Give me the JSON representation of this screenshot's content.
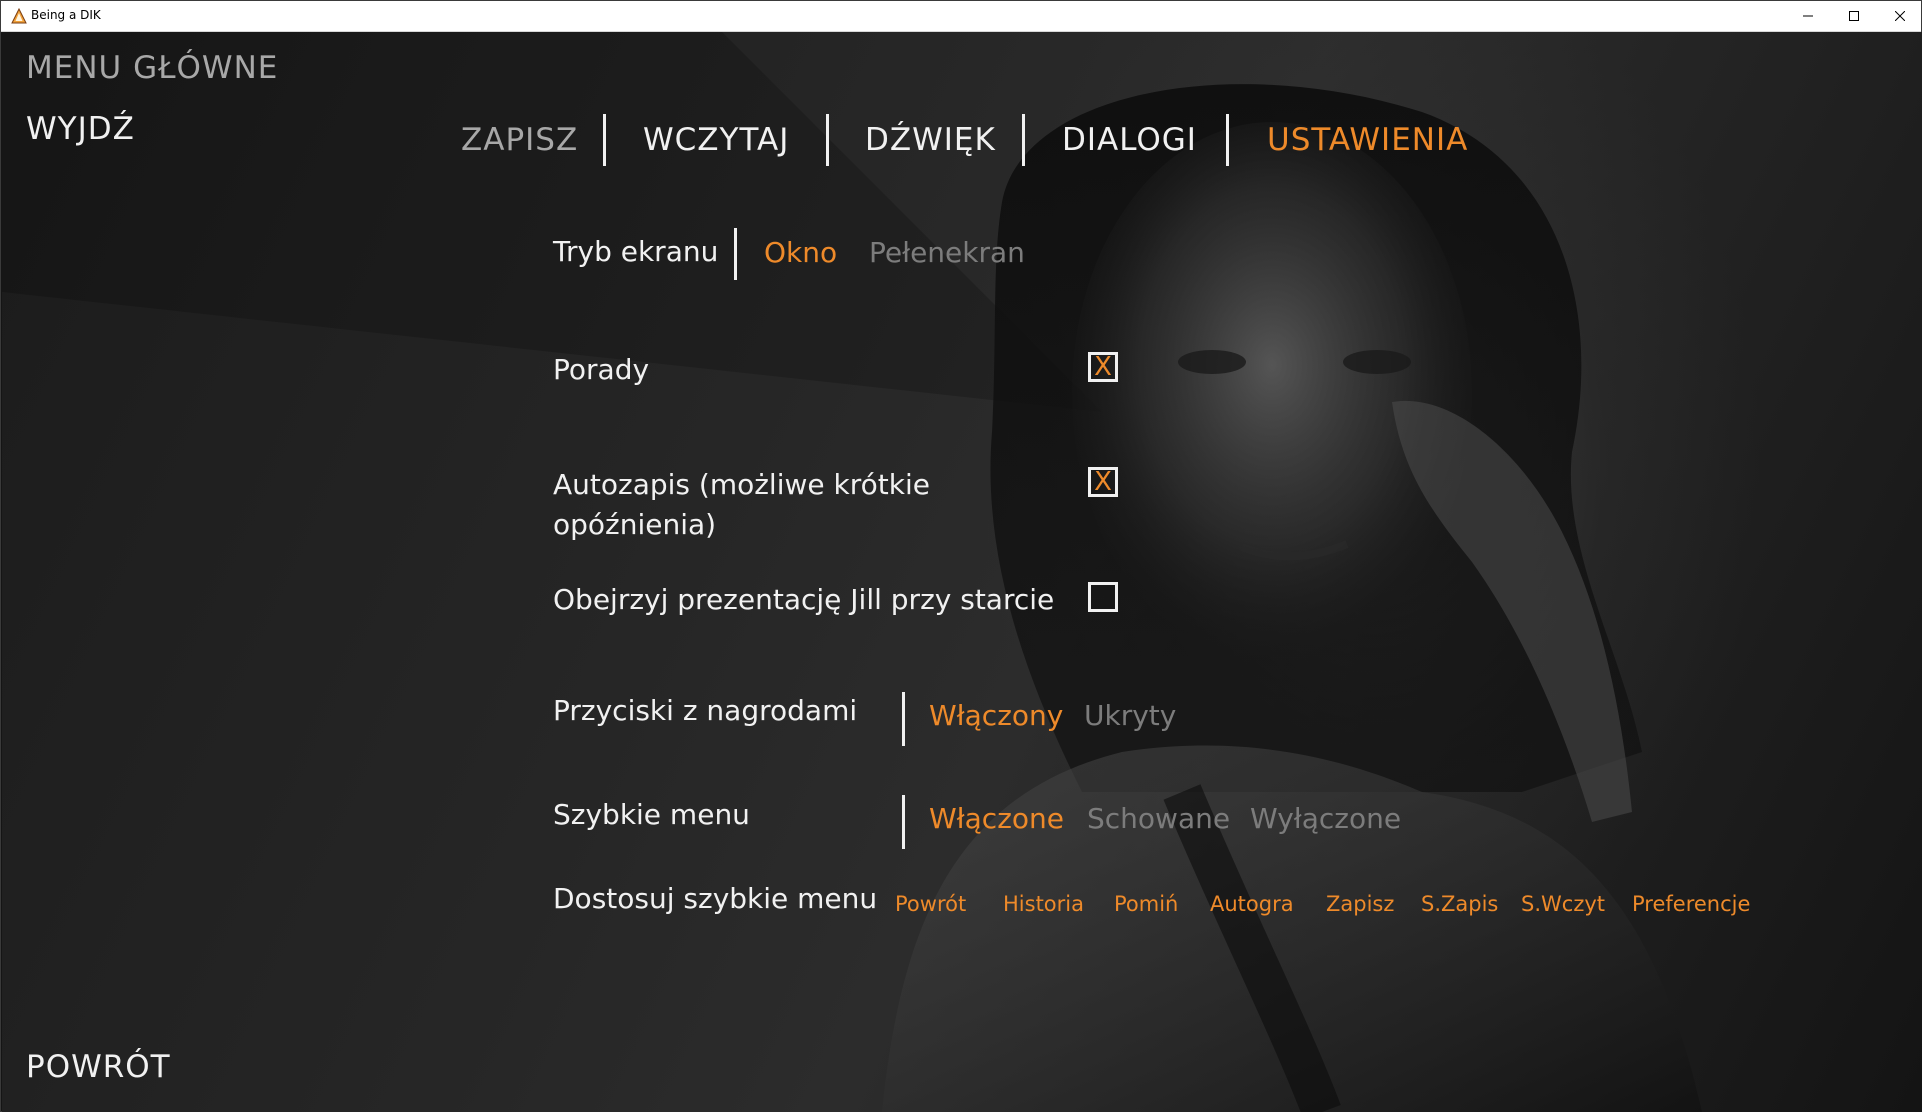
{
  "window": {
    "title": "Being a DIK",
    "app_icon": "triangle-app-icon",
    "controls": [
      "minimize-icon",
      "maximize-icon",
      "close-icon"
    ]
  },
  "menu": {
    "main": "MENU GŁÓWNE",
    "quit": "WYJDŹ",
    "return": "POWRÓT"
  },
  "tabs": [
    {
      "label": "ZAPISZ",
      "state": "disabled"
    },
    {
      "label": "WCZYTAJ",
      "state": "normal"
    },
    {
      "label": "DŹWIĘK",
      "state": "normal"
    },
    {
      "label": "DIALOGI",
      "state": "normal"
    },
    {
      "label": "USTAWIENIA",
      "state": "active"
    }
  ],
  "settings": {
    "screen_mode": {
      "label": "Tryb ekranu",
      "options": [
        "Okno",
        "Pełenekran"
      ],
      "selected": "Okno"
    },
    "tips": {
      "label": "Porady",
      "checked": true,
      "mark": "X"
    },
    "autosave": {
      "label_line1": "Autozapis (możliwe krótkie",
      "label_line2": "opóźnienia)",
      "checked": true,
      "mark": "X"
    },
    "jill_intro": {
      "label": "Obejrzyj prezentację Jill przy starcie",
      "checked": false,
      "mark": ""
    },
    "reward_buttons": {
      "label": "Przyciski z nagrodami",
      "options": [
        "Włączony",
        "Ukryty"
      ],
      "selected": "Włączony"
    },
    "quick_menu": {
      "label": "Szybkie menu",
      "options": [
        "Włączone",
        "Schowane",
        "Wyłączone"
      ],
      "selected": "Włączone"
    },
    "customize_quick_menu": {
      "label": "Dostosuj szybkie menu",
      "items": [
        "Powrót",
        "Historia",
        "Pomiń",
        "Autogra",
        "Zapisz",
        "S.Zapis",
        "S.Wczyt",
        "Preferencje"
      ]
    }
  },
  "colors": {
    "accent": "#ee8a2a",
    "text": "#f1f1f1",
    "inactive": "#7c7c7c",
    "disabled": "#a8a8a8",
    "background": "#1b1b1b"
  }
}
